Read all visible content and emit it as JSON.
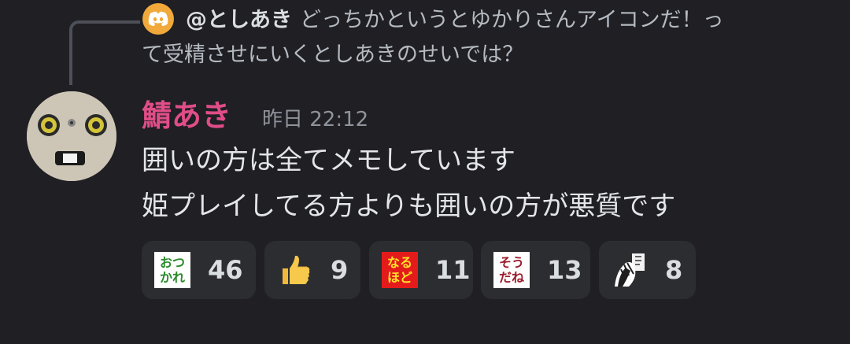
{
  "reply": {
    "author": "@としあき",
    "text_line1": "どっちかというとゆかりさんアイコンだ！っ",
    "text_line2": "て受精させにいくとしあきのせいでは？"
  },
  "message": {
    "username": "鯖あき",
    "timestamp": "昨日 22:12",
    "lines": [
      "囲いの方は全てメモしています",
      "姫プレイしてる方よりも囲いの方が悪質です"
    ]
  },
  "reactions": [
    {
      "icon": "otsukare-emoji",
      "label": "おつかれ",
      "count": "46"
    },
    {
      "icon": "thumbs-up-emoji",
      "label": "",
      "count": "9"
    },
    {
      "icon": "naruhodo-emoji",
      "label": "なるほど",
      "count": "11"
    },
    {
      "icon": "soudane-emoji",
      "label": "そうだね",
      "count": "13"
    },
    {
      "icon": "manga-character-emoji",
      "label": "",
      "count": "8"
    }
  ],
  "colors": {
    "background": "#1f1f24",
    "username": "#e04d88",
    "reaction_bg": "#2b2d31",
    "discord_badge": "#f0a93a"
  }
}
